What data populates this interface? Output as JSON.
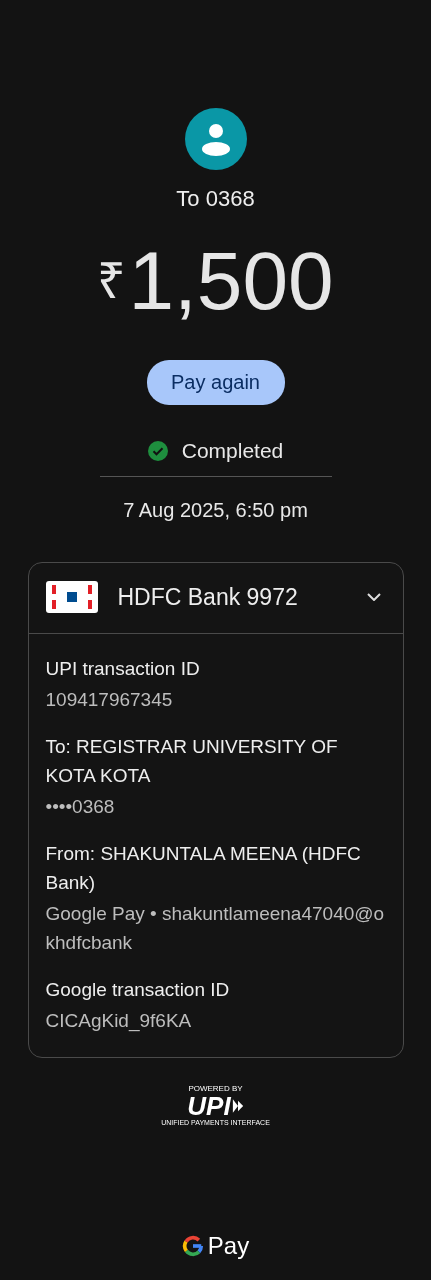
{
  "recipient": {
    "title": "To 0368"
  },
  "amount": {
    "currency": "₹",
    "value": "1,500"
  },
  "pay_again_button": "Pay again",
  "status": {
    "kind": "completed",
    "label": "Completed"
  },
  "datetime": "7 Aug 2025, 6:50 pm",
  "account_card": {
    "bank": "HDFC Bank 9972",
    "expanded": true,
    "details": [
      {
        "label": "UPI transaction ID",
        "value": "109417967345"
      },
      {
        "label": "To: REGISTRAR UNIVERSITY OF KOTA KOTA",
        "value": "••••0368"
      },
      {
        "label": "From: SHAKUNTALA MEENA (HDFC Bank)",
        "value": "Google Pay • shakuntlameena47040@okhdfcbank"
      },
      {
        "label": "Google transaction ID",
        "value": "CICAgKid_9f6KA"
      }
    ]
  },
  "upi_badge": {
    "top": "POWERED BY",
    "logo": "UPI",
    "bottom": "UNIFIED PAYMENTS INTERFACE"
  },
  "footer_brand": "Pay"
}
